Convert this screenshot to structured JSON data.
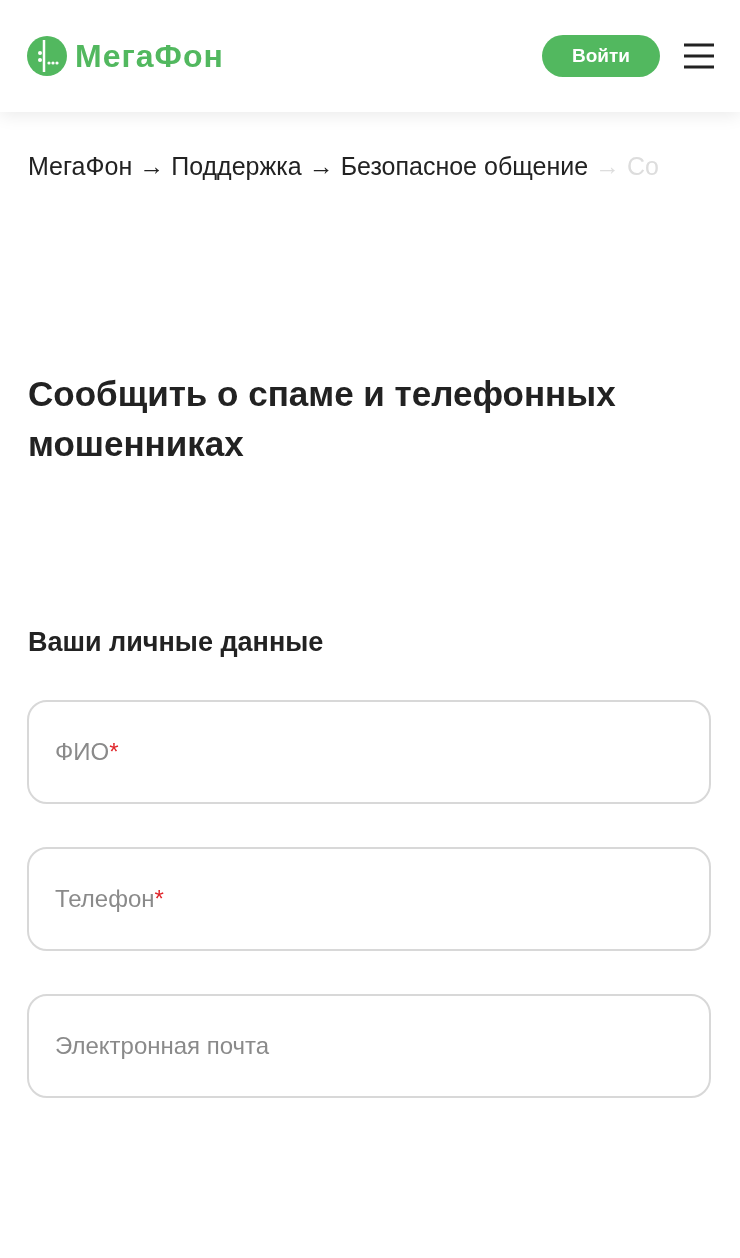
{
  "header": {
    "logo_text": "МегаФон",
    "login_button": "Войти"
  },
  "breadcrumbs": [
    {
      "label": "МегаФон",
      "current": false
    },
    {
      "label": "Поддержка",
      "current": false
    },
    {
      "label": "Безопасное общение",
      "current": false
    },
    {
      "label": "Со",
      "current": true
    }
  ],
  "breadcrumb_separator": "→",
  "title": "Сообщить о спаме и телефонных мошенниках",
  "section_title": "Ваши личные данные",
  "fields": [
    {
      "placeholder": "ФИО",
      "required": true
    },
    {
      "placeholder": "Телефон",
      "required": true
    },
    {
      "placeholder": "Электронная почта",
      "required": false
    }
  ],
  "required_mark": "*"
}
